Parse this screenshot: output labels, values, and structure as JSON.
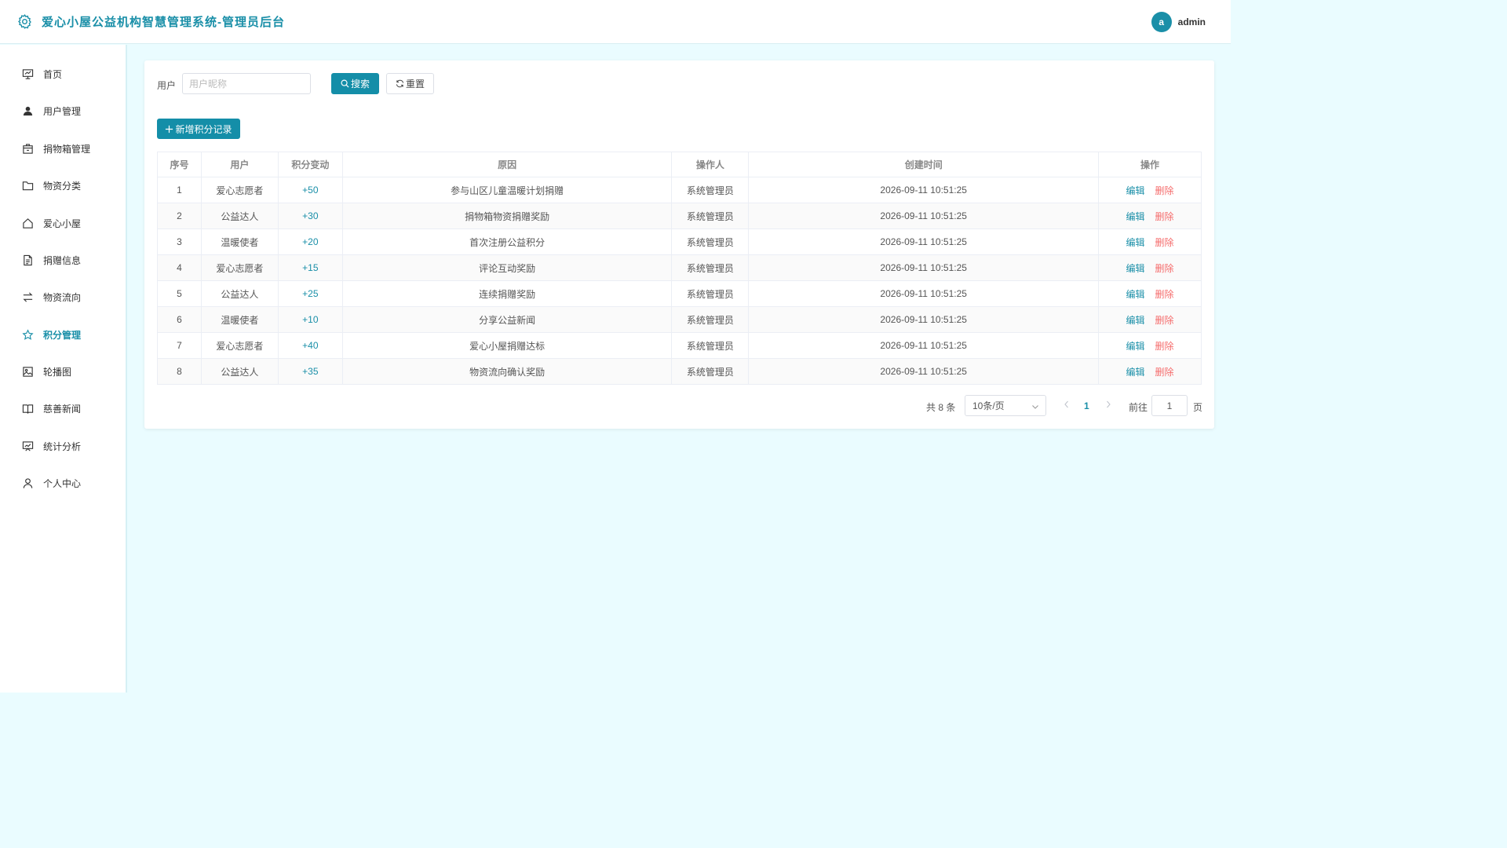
{
  "header": {
    "title": "爱心小屋公益机构智慧管理系统-管理员后台",
    "avatar_letter": "a",
    "username": "admin"
  },
  "colors": {
    "accent": "#148ea8",
    "danger": "#f56c6c",
    "background": "#eafcff"
  },
  "sidebar": {
    "items": [
      {
        "label": "首页",
        "icon": "dashboard-icon"
      },
      {
        "label": "用户管理",
        "icon": "user-icon"
      },
      {
        "label": "捐物箱管理",
        "icon": "box-icon"
      },
      {
        "label": "物资分类",
        "icon": "folder-icon"
      },
      {
        "label": "爱心小屋",
        "icon": "house-icon"
      },
      {
        "label": "捐赠信息",
        "icon": "document-icon"
      },
      {
        "label": "物资流向",
        "icon": "transfer-icon"
      },
      {
        "label": "积分管理",
        "icon": "star-icon",
        "active": true
      },
      {
        "label": "轮播图",
        "icon": "image-icon"
      },
      {
        "label": "慈善新闻",
        "icon": "book-icon"
      },
      {
        "label": "统计分析",
        "icon": "chart-board-icon"
      },
      {
        "label": "个人中心",
        "icon": "person-icon"
      }
    ]
  },
  "search": {
    "label": "用户",
    "placeholder": "用户昵称",
    "value": "",
    "search_label": "搜索",
    "reset_label": "重置"
  },
  "toolbar": {
    "add_label": "新增积分记录"
  },
  "table": {
    "headers": [
      "序号",
      "用户",
      "积分变动",
      "原因",
      "操作人",
      "创建时间",
      "操作"
    ],
    "rows": [
      {
        "index": "1",
        "user": "爱心志愿者",
        "change": "+50",
        "reason": "参与山区儿童温暖计划捐赠",
        "operator": "系统管理员",
        "time": "2026-09-11 10:51:25"
      },
      {
        "index": "2",
        "user": "公益达人",
        "change": "+30",
        "reason": "捐物箱物资捐赠奖励",
        "operator": "系统管理员",
        "time": "2026-09-11 10:51:25"
      },
      {
        "index": "3",
        "user": "温暖使者",
        "change": "+20",
        "reason": "首次注册公益积分",
        "operator": "系统管理员",
        "time": "2026-09-11 10:51:25"
      },
      {
        "index": "4",
        "user": "爱心志愿者",
        "change": "+15",
        "reason": "评论互动奖励",
        "operator": "系统管理员",
        "time": "2026-09-11 10:51:25"
      },
      {
        "index": "5",
        "user": "公益达人",
        "change": "+25",
        "reason": "连续捐赠奖励",
        "operator": "系统管理员",
        "time": "2026-09-11 10:51:25"
      },
      {
        "index": "6",
        "user": "温暖使者",
        "change": "+10",
        "reason": "分享公益新闻",
        "operator": "系统管理员",
        "time": "2026-09-11 10:51:25"
      },
      {
        "index": "7",
        "user": "爱心志愿者",
        "change": "+40",
        "reason": "爱心小屋捐赠达标",
        "operator": "系统管理员",
        "time": "2026-09-11 10:51:25"
      },
      {
        "index": "8",
        "user": "公益达人",
        "change": "+35",
        "reason": "物资流向确认奖励",
        "operator": "系统管理员",
        "time": "2026-09-11 10:51:25"
      }
    ],
    "edit_label": "编辑",
    "delete_label": "删除"
  },
  "pagination": {
    "total_text": "共 8 条",
    "page_size": "10条/页",
    "current_page": "1",
    "goto_label": "前往",
    "goto_value": "1",
    "page_suffix": "页"
  }
}
